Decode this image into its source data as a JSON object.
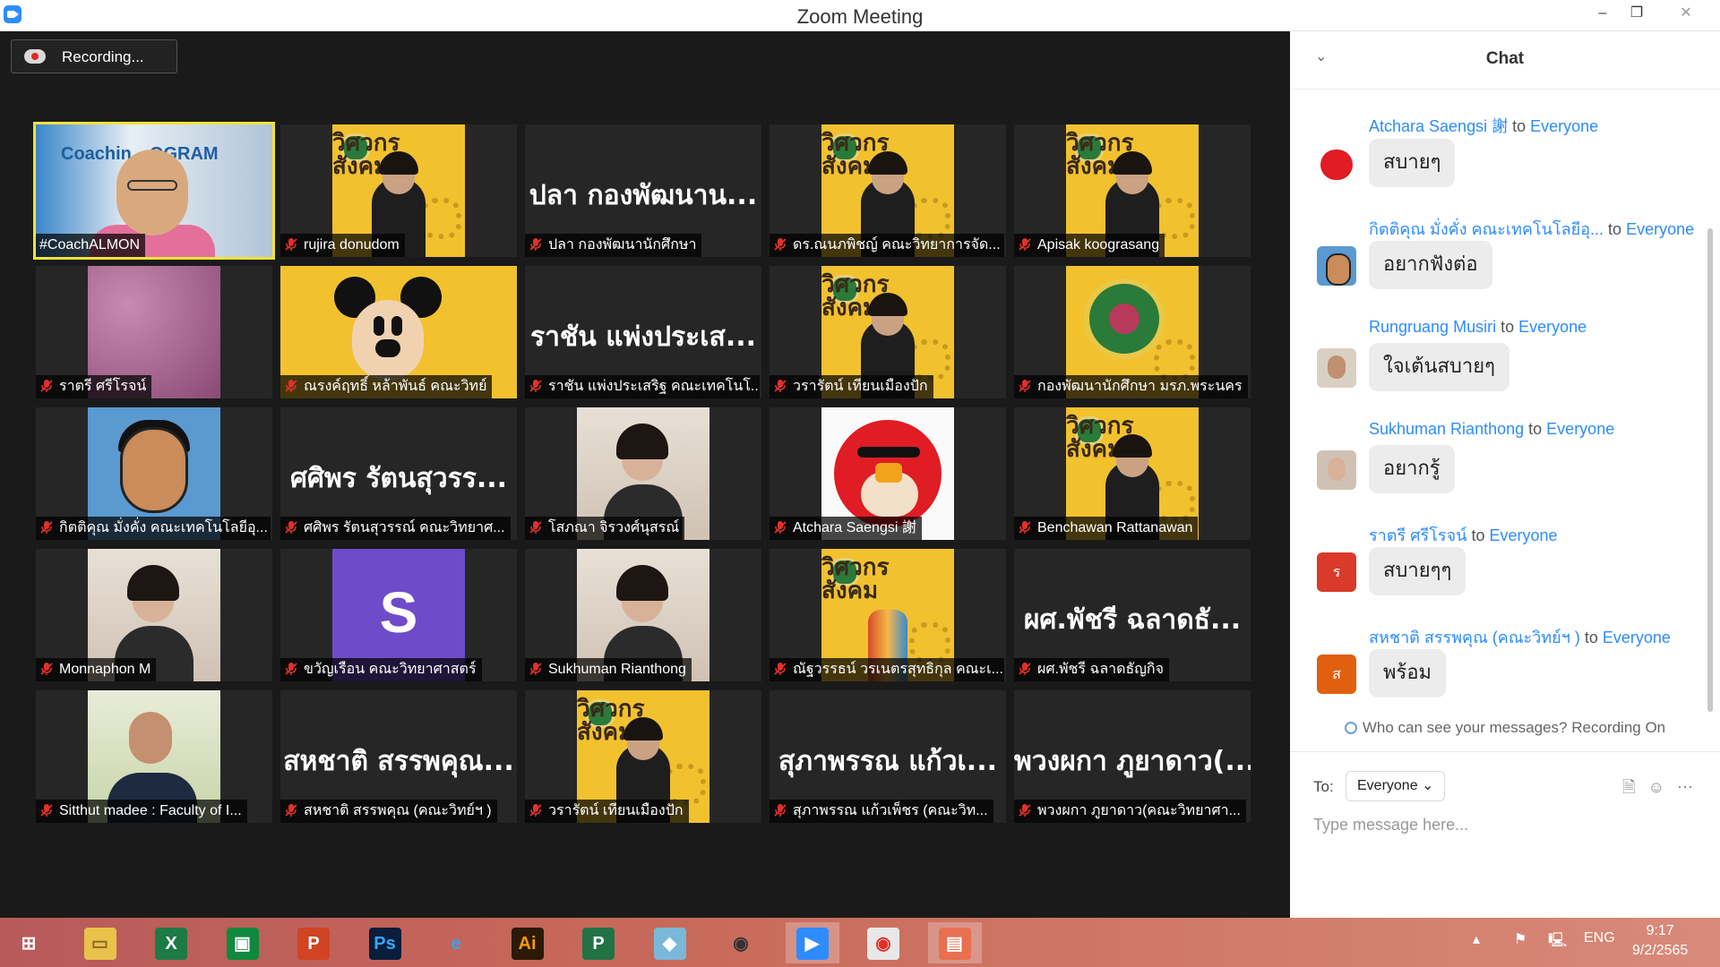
{
  "window": {
    "title": "Zoom Meeting",
    "minimize": "–",
    "maximize": "❐",
    "close": "✕"
  },
  "recording": {
    "label": "Recording..."
  },
  "participants": [
    {
      "name": "#CoachALMON",
      "pic": "coach",
      "poster_text": "Coachin…OGRAM"
    },
    {
      "name": "rujira donudom",
      "pic": "poster"
    },
    {
      "name": "ปลา กองพัฒนานักศึกษา",
      "big": "ปลา กองพัฒนาน..."
    },
    {
      "name": "ดร.ณนภพิชญ์ คณะวิทยาการจัด...",
      "pic": "poster"
    },
    {
      "name": "Apisak koograsang",
      "pic": "poster"
    },
    {
      "name": "ราตรี ศรีโรจน์",
      "pic": "leather"
    },
    {
      "name": "ณรงค์ฤทธิ์ หล้าพันธ์ คณะวิทย์",
      "pic": "mickey"
    },
    {
      "name": "ราชัน แพ่งประเสริฐ คณะเทคโนโ...",
      "big": "ราชัน แพ่งประเส..."
    },
    {
      "name": "วรารัตน์ เทียนเมืองปัก",
      "pic": "poster"
    },
    {
      "name": "กองพัฒนานักศึกษา มรภ.พระนคร",
      "pic": "seal"
    },
    {
      "name": "กิตติคุณ มั่งคั่ง คณะเทคโนโลยีอุ...",
      "pic": "cartoon"
    },
    {
      "name": "ศศิพร รัตนสุวรรณ์ คณะวิทยาศ...",
      "big": "ศศิพร รัตนสุวรร..."
    },
    {
      "name": "โสภณา จิรวงศ์นุสรณ์",
      "pic": "photo"
    },
    {
      "name": "Atchara Saengsi 謝",
      "pic": "bird"
    },
    {
      "name": "Benchawan Rattanawan",
      "pic": "poster"
    },
    {
      "name": "Monnaphon M",
      "pic": "photo"
    },
    {
      "name": "ขวัญเรือน คณะวิทยาศาสตร์",
      "pic": "s",
      "avatar_letter": "S"
    },
    {
      "name": "Sukhuman Rianthong",
      "pic": "photo"
    },
    {
      "name": "ณัฐวรรธน์ วรเนตรสุทธิกุล คณะเ...",
      "pic": "poster2"
    },
    {
      "name": "ผศ.พัชรี ฉลาดธัญกิจ",
      "big": "ผศ.พัชรี ฉลาดธั..."
    },
    {
      "name": "Sitthut madee : Faculty of I...",
      "pic": "suit"
    },
    {
      "name": "สหชาติ สรรพคุณ (คณะวิทย์ฯ )",
      "big": "สหชาติ สรรพคุณ..."
    },
    {
      "name": "วรารัตน์ เทียนเมืองปัก",
      "pic": "poster"
    },
    {
      "name": "สุภาพรรณ แก้วเพ็ชร (คณะวิท...",
      "big": "สุภาพรรณ แก้วเ..."
    },
    {
      "name": "พวงผกา ภูยาดาว(คณะวิทยาศา...",
      "big": "พวงผกา ภูยาดาว(..."
    }
  ],
  "poster_header": "วิศวกร สังคม",
  "chat": {
    "title": "Chat",
    "to_word": "to",
    "messages": [
      {
        "sender": "Atchara Saengsi 謝",
        "to": "Everyone",
        "text": "สบายๆ",
        "avatar": "bird"
      },
      {
        "sender": "กิตติคุณ มั่งคั่ง คณะเทคโนโลยีอุ...",
        "to": "Everyone",
        "text": "อยากฟังต่อ",
        "avatar": "man"
      },
      {
        "sender": "Rungruang Musiri",
        "to": "Everyone",
        "text": "ใจเต้นสบายๆ",
        "avatar": "photo1"
      },
      {
        "sender": "Sukhuman Rianthong",
        "to": "Everyone",
        "text": "อยากรู้",
        "avatar": "photo2"
      },
      {
        "sender": "ราตรี ศรีโรจน์",
        "to": "Everyone",
        "text": "สบายๆๆ",
        "avatar": "letter",
        "letter": "ร",
        "color": "#d93a2a"
      },
      {
        "sender": "สหชาติ สรรพคุณ (คณะวิทย์ฯ )",
        "to": "Everyone",
        "text": "พร้อม",
        "avatar": "letter",
        "letter": "ส",
        "color": "#e06010"
      }
    ],
    "visibility_note": "Who can see your messages? Recording On",
    "to_label": "To:",
    "to_value": "Everyone",
    "placeholder": "Type message here..."
  },
  "taskbar": {
    "apps": [
      "start",
      "file-explorer",
      "excel",
      "store",
      "powerpoint",
      "photoshop",
      "internet-explorer",
      "illustrator",
      "project",
      "paint",
      "photoscape",
      "zoom",
      "chrome",
      "photos"
    ],
    "lang": "ENG",
    "time": "9:17",
    "date": "9/2/2565"
  },
  "colors": {
    "accent": "#2d8cff",
    "active_speaker": "#f5e23a",
    "mic_muted": "#e0312b"
  }
}
